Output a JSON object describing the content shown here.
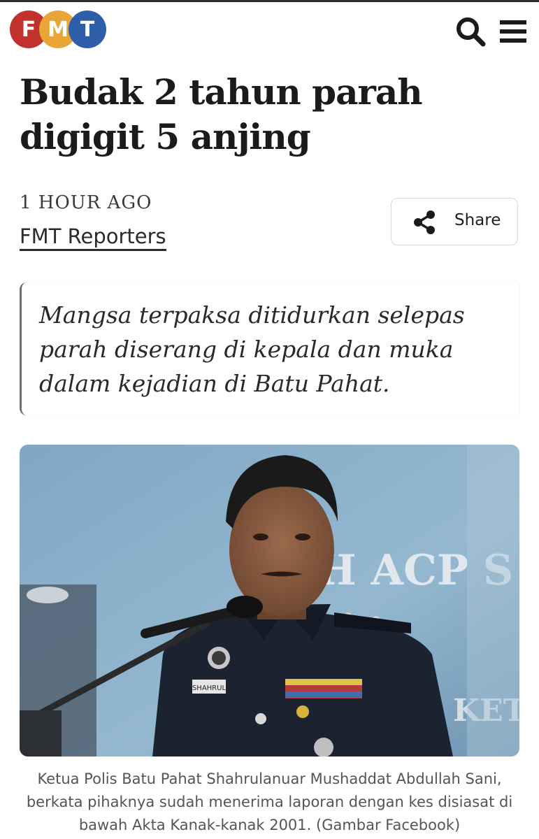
{
  "header": {
    "logo_letters": [
      "F",
      "M",
      "T"
    ],
    "logo_colors": [
      "#c1312d",
      "#e8a637",
      "#2e5eaa"
    ],
    "search_icon": "search-icon",
    "menu_icon": "hamburger-menu-icon"
  },
  "article": {
    "title": "Budak 2 tahun parah digigit 5 anjing",
    "time": "1 HOUR AGO",
    "author": "FMT Reporters",
    "share_label": "Share",
    "standfirst": "Mangsa terpaksa ditidurkan selepas parah diserang di kepala dan muka dalam kejadian di Batu Pahat.",
    "photo": {
      "backdrop_text": "H ACP S",
      "backdrop_text_2": "KET",
      "name_tag": "SHAHRUL"
    },
    "caption": "Ketua Polis Batu Pahat Shahrulanuar Mushaddat Abdullah Sani, berkata pihaknya sudah menerima laporan dengan kes disiasat di bawah Akta Kanak-kanak 2001. (Gambar Facebook)"
  }
}
